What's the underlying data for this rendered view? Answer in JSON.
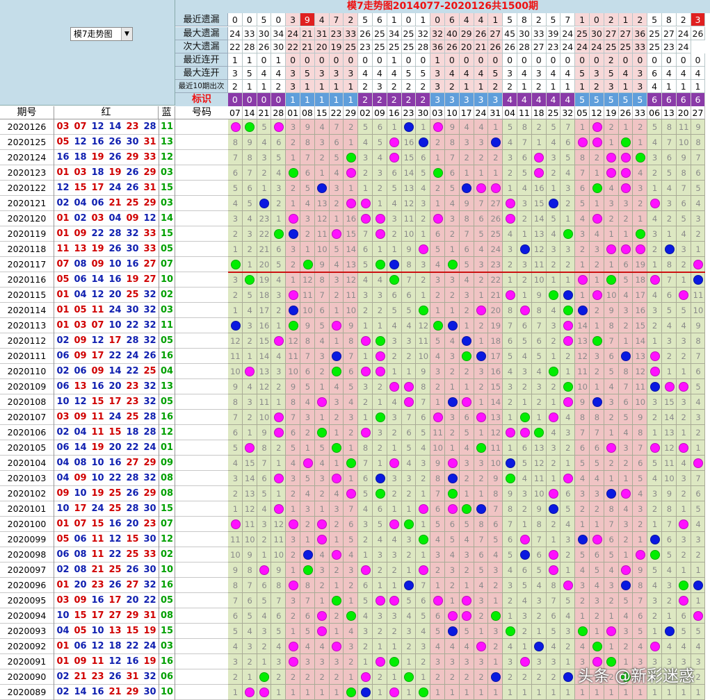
{
  "selector": {
    "value": "模7走势图"
  },
  "title": "模7走势图2014077-2020126共1500期",
  "stat_rows": [
    {
      "label": "最近遗漏",
      "values": [
        "0",
        "0",
        "5",
        "0",
        "3",
        "9",
        "4",
        "7",
        "2",
        "5",
        "6",
        "1",
        "0",
        "1",
        "0",
        "6",
        "4",
        "4",
        "1",
        "5",
        "8",
        "2",
        "5",
        "7",
        "1",
        "0",
        "2",
        "1",
        "2",
        "5",
        "8",
        "2",
        "3"
      ]
    },
    {
      "label": "最大遗漏",
      "values": [
        "24",
        "33",
        "30",
        "34",
        "24",
        "21",
        "31",
        "23",
        "33",
        "26",
        "25",
        "34",
        "25",
        "32",
        "32",
        "40",
        "29",
        "26",
        "27",
        "45",
        "30",
        "33",
        "39",
        "24",
        "25",
        "30",
        "27",
        "27",
        "36",
        "25",
        "27",
        "24",
        "26"
      ]
    },
    {
      "label": "次大遗漏",
      "values": [
        "22",
        "28",
        "26",
        "30",
        "22",
        "21",
        "20",
        "19",
        "25",
        "23",
        "25",
        "25",
        "25",
        "28",
        "36",
        "26",
        "20",
        "21",
        "26",
        "26",
        "28",
        "27",
        "23",
        "24",
        "24",
        "24",
        "25",
        "25",
        "33",
        "25",
        "23",
        "24"
      ]
    },
    {
      "label": "最近连开",
      "values": [
        "1",
        "1",
        "0",
        "1",
        "0",
        "0",
        "0",
        "0",
        "0",
        "0",
        "0",
        "1",
        "0",
        "0",
        "1",
        "0",
        "0",
        "0",
        "0",
        "0",
        "0",
        "0",
        "0",
        "0",
        "0",
        "0",
        "2",
        "0",
        "0",
        "0",
        "0",
        "0",
        "0"
      ]
    },
    {
      "label": "最大连开",
      "values": [
        "3",
        "5",
        "4",
        "4",
        "3",
        "5",
        "3",
        "3",
        "3",
        "4",
        "4",
        "4",
        "5",
        "5",
        "3",
        "4",
        "4",
        "4",
        "5",
        "3",
        "4",
        "3",
        "4",
        "4",
        "5",
        "3",
        "5",
        "4",
        "3",
        "6",
        "4",
        "4",
        "4"
      ]
    },
    {
      "label": "最近10期出次",
      "values": [
        "2",
        "1",
        "1",
        "2",
        "3",
        "1",
        "1",
        "1",
        "1",
        "2",
        "3",
        "2",
        "2",
        "2",
        "3",
        "2",
        "1",
        "1",
        "2",
        "2",
        "1",
        "2",
        "1",
        "1",
        "1",
        "2",
        "3",
        "1",
        "3",
        "4",
        "1",
        "1",
        "1"
      ]
    }
  ],
  "tag_row": {
    "label": "标识",
    "values": [
      "0",
      "0",
      "0",
      "0",
      "1",
      "1",
      "1",
      "1",
      "1",
      "2",
      "2",
      "2",
      "2",
      "2",
      "3",
      "3",
      "3",
      "3",
      "3",
      "4",
      "4",
      "4",
      "4",
      "4",
      "5",
      "5",
      "5",
      "5",
      "5",
      "6",
      "6",
      "6",
      "6"
    ]
  },
  "header": {
    "issue": "期号",
    "red": "红",
    "blue": "蓝",
    "code": "号码"
  },
  "columns": [
    "07",
    "14",
    "21",
    "28",
    "01",
    "08",
    "15",
    "22",
    "29",
    "02",
    "09",
    "16",
    "23",
    "30",
    "03",
    "10",
    "17",
    "24",
    "31",
    "04",
    "11",
    "18",
    "25",
    "32",
    "05",
    "12",
    "19",
    "26",
    "33",
    "06",
    "13",
    "20",
    "27"
  ],
  "draws": [
    {
      "issue": "2020126",
      "red": [
        "03",
        "07",
        "12",
        "14",
        "23",
        "28"
      ],
      "blue": "11"
    },
    {
      "issue": "2020125",
      "red": [
        "05",
        "12",
        "16",
        "26",
        "30",
        "31"
      ],
      "blue": "13"
    },
    {
      "issue": "2020124",
      "red": [
        "16",
        "18",
        "19",
        "26",
        "29",
        "33"
      ],
      "blue": "12"
    },
    {
      "issue": "2020123",
      "red": [
        "01",
        "03",
        "18",
        "19",
        "26",
        "29"
      ],
      "blue": "03"
    },
    {
      "issue": "2020122",
      "red": [
        "12",
        "15",
        "17",
        "24",
        "26",
        "31"
      ],
      "blue": "15"
    },
    {
      "issue": "2020121",
      "red": [
        "02",
        "04",
        "06",
        "21",
        "25",
        "29"
      ],
      "blue": "03"
    },
    {
      "issue": "2020120",
      "red": [
        "01",
        "02",
        "03",
        "04",
        "09",
        "12"
      ],
      "blue": "14"
    },
    {
      "issue": "2020119",
      "red": [
        "01",
        "09",
        "22",
        "28",
        "32",
        "33"
      ],
      "blue": "15"
    },
    {
      "issue": "2020118",
      "red": [
        "11",
        "13",
        "19",
        "26",
        "30",
        "33"
      ],
      "blue": "05"
    },
    {
      "issue": "2020117",
      "red": [
        "07",
        "08",
        "09",
        "10",
        "16",
        "27"
      ],
      "blue": "07"
    },
    {
      "issue": "2020116",
      "red": [
        "05",
        "06",
        "14",
        "16",
        "19",
        "27"
      ],
      "blue": "10"
    },
    {
      "issue": "2020115",
      "red": [
        "01",
        "04",
        "12",
        "20",
        "25",
        "32"
      ],
      "blue": "02"
    },
    {
      "issue": "2020114",
      "red": [
        "01",
        "05",
        "11",
        "24",
        "30",
        "32"
      ],
      "blue": "03"
    },
    {
      "issue": "2020113",
      "red": [
        "01",
        "03",
        "07",
        "10",
        "22",
        "32"
      ],
      "blue": "11"
    },
    {
      "issue": "2020112",
      "red": [
        "02",
        "09",
        "12",
        "17",
        "28",
        "32"
      ],
      "blue": "05"
    },
    {
      "issue": "2020111",
      "red": [
        "06",
        "09",
        "17",
        "22",
        "24",
        "26"
      ],
      "blue": "16"
    },
    {
      "issue": "2020110",
      "red": [
        "02",
        "06",
        "09",
        "14",
        "22",
        "25"
      ],
      "blue": "04"
    },
    {
      "issue": "2020109",
      "red": [
        "06",
        "13",
        "16",
        "20",
        "23",
        "32"
      ],
      "blue": "13"
    },
    {
      "issue": "2020108",
      "red": [
        "10",
        "12",
        "15",
        "17",
        "23",
        "32"
      ],
      "blue": "05"
    },
    {
      "issue": "2020107",
      "red": [
        "03",
        "09",
        "11",
        "24",
        "25",
        "28"
      ],
      "blue": "16"
    },
    {
      "issue": "2020106",
      "red": [
        "02",
        "04",
        "11",
        "15",
        "18",
        "28"
      ],
      "blue": "12"
    },
    {
      "issue": "2020105",
      "red": [
        "06",
        "14",
        "19",
        "20",
        "22",
        "24"
      ],
      "blue": "01"
    },
    {
      "issue": "2020104",
      "red": [
        "04",
        "08",
        "10",
        "16",
        "27",
        "29"
      ],
      "blue": "09"
    },
    {
      "issue": "2020103",
      "red": [
        "04",
        "09",
        "10",
        "22",
        "28",
        "32"
      ],
      "blue": "08"
    },
    {
      "issue": "2020102",
      "red": [
        "09",
        "10",
        "19",
        "25",
        "26",
        "29"
      ],
      "blue": "08"
    },
    {
      "issue": "2020101",
      "red": [
        "10",
        "17",
        "24",
        "25",
        "28",
        "30"
      ],
      "blue": "15"
    },
    {
      "issue": "2020100",
      "red": [
        "01",
        "07",
        "15",
        "16",
        "20",
        "23"
      ],
      "blue": "07"
    },
    {
      "issue": "2020099",
      "red": [
        "05",
        "06",
        "11",
        "12",
        "15",
        "30"
      ],
      "blue": "12"
    },
    {
      "issue": "2020098",
      "red": [
        "06",
        "08",
        "11",
        "22",
        "25",
        "33"
      ],
      "blue": "02"
    },
    {
      "issue": "2020097",
      "red": [
        "02",
        "08",
        "21",
        "25",
        "26",
        "30"
      ],
      "blue": "10"
    },
    {
      "issue": "2020096",
      "red": [
        "01",
        "20",
        "23",
        "26",
        "27",
        "32"
      ],
      "blue": "16"
    },
    {
      "issue": "2020095",
      "red": [
        "03",
        "09",
        "16",
        "17",
        "20",
        "22"
      ],
      "blue": "05"
    },
    {
      "issue": "2020094",
      "red": [
        "10",
        "15",
        "17",
        "27",
        "29",
        "31"
      ],
      "blue": "08"
    },
    {
      "issue": "2020093",
      "red": [
        "04",
        "05",
        "10",
        "13",
        "15",
        "19"
      ],
      "blue": "15"
    },
    {
      "issue": "2020092",
      "red": [
        "01",
        "06",
        "12",
        "18",
        "22",
        "24"
      ],
      "blue": "03"
    },
    {
      "issue": "2020091",
      "red": [
        "01",
        "09",
        "11",
        "12",
        "16",
        "19"
      ],
      "blue": "16"
    },
    {
      "issue": "2020090",
      "red": [
        "02",
        "21",
        "23",
        "26",
        "31",
        "32"
      ],
      "blue": "06"
    },
    {
      "issue": "2020089",
      "red": [
        "02",
        "14",
        "16",
        "21",
        "29",
        "30"
      ],
      "blue": "10"
    }
  ],
  "watermark": "头条 @新彩迷惑",
  "colors": {
    "header_bg": "#c5dde9",
    "cell_green": "#dde8c2",
    "cell_pink": "#f0c4c4",
    "tag_purple": "#8a3aa8",
    "tag_blue": "#5f9edb",
    "title_red": "#ee1111",
    "ball_magenta": "#ff10ff",
    "ball_green": "#00ee00",
    "ball_blue": "#0a19e0",
    "separator": "#cc1111"
  }
}
